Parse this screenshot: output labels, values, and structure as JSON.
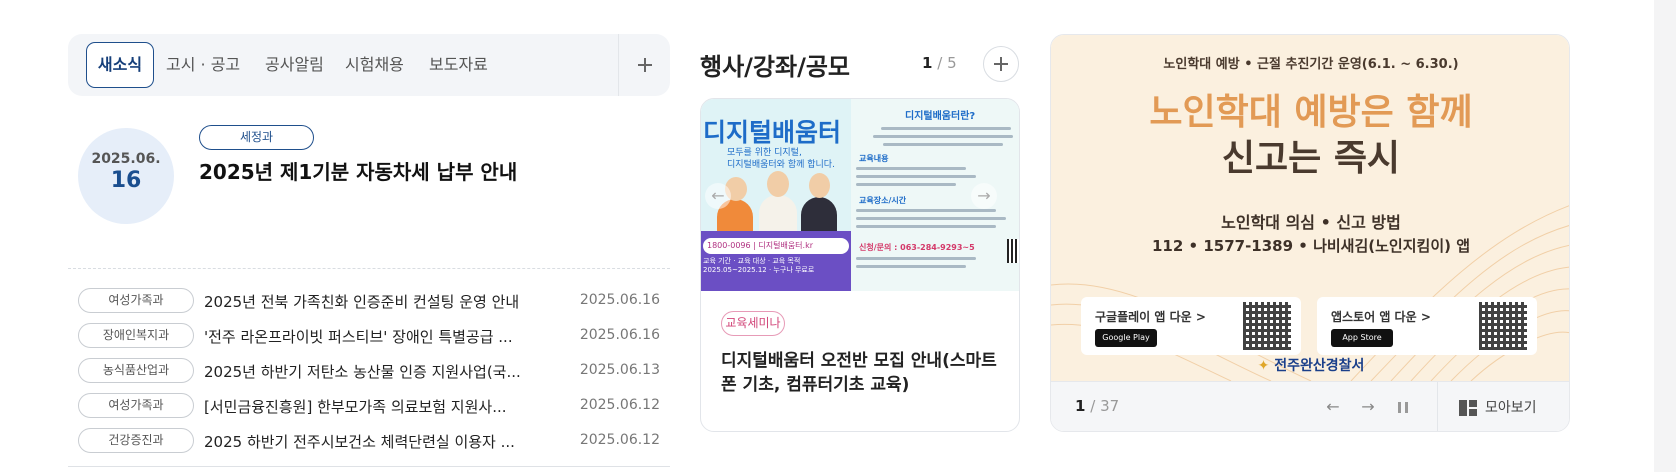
{
  "news": {
    "tabs": [
      "새소식",
      "고시 · 공고",
      "공사알림",
      "시험채용",
      "보도자료"
    ],
    "featured": {
      "date_ym": "2025.06.",
      "date_day": "16",
      "dept": "세정과",
      "title": "2025년 제1기분 자동차세 납부 안내"
    },
    "rows": [
      {
        "dept": "여성가족과",
        "title": "2025년 전북 가족친화 인증준비 컨설팅 운영 안내",
        "date": "2025.06.16"
      },
      {
        "dept": "장애인복지과",
        "title": "'전주 라온프라이빗 퍼스티브' 장애인 특별공급 ...",
        "date": "2025.06.16"
      },
      {
        "dept": "농식품산업과",
        "title": "2025년 하반기 저탄소 농산물 인증 지원사업(국...",
        "date": "2025.06.13"
      },
      {
        "dept": "여성가족과",
        "title": "[서민금융진흥원] 한부모가족 의료보험 지원사...",
        "date": "2025.06.12"
      },
      {
        "dept": "건강증진과",
        "title": "2025 하반기 전주시보건소 체력단련실 이용자 ...",
        "date": "2025.06.12"
      }
    ]
  },
  "events": {
    "title": "행사/강좌/공모",
    "page_current": "1",
    "page_sep": "/",
    "page_total": "5",
    "card": {
      "poster": {
        "headline": "디지털배움터",
        "sub_line1": "모두를 위한 디지털,",
        "sub_line2": "디지털배움터와 함께 합니다.",
        "phone_line": "1800-0096 | 디지털배움터.kr",
        "info_title": "디지털배움터란?",
        "label_edu": "교육내용",
        "label_place": "교육장소/시간",
        "label_contact": "신청/문의 : 063-284-9293~5",
        "bottom_line1": "교육 기간 · 교육 대상 · 교육 목적",
        "bottom_line2": "2025.05~2025.12 · 누구나 무료로"
      },
      "badge": "교육세미나",
      "title": "디지털배움터 오전반 모집 안내(스마트폰 기초, 컴퓨터기초 교육)"
    }
  },
  "banner": {
    "top_line": "노인학대 예방 • 근절 추진기간 운영(6.1. ~ 6.30.)",
    "headline1": "노인학대 예방은 함께",
    "headline2": "신고는 즉시",
    "method_title": "노인학대 의심 • 신고 방법",
    "method_numbers": "112 • 1577-1389  • 나비새김(노인지킴이) 앱",
    "google_label": "구글플레이 앱 다운 >",
    "google_btn": "Google Play",
    "apple_label": "앱스토어 앱 다운 >",
    "apple_btn": "App Store",
    "police": "전주완산경찰서",
    "page_current": "1",
    "page_sep": "/",
    "page_total": "37",
    "view_all": "모아보기"
  }
}
